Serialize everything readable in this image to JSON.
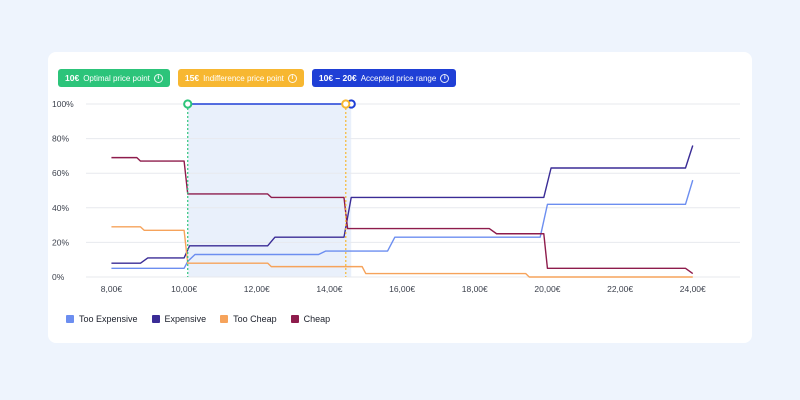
{
  "badges": [
    {
      "value": "10€",
      "label": "Optimal price point",
      "color": "#2cc47a"
    },
    {
      "value": "15€",
      "label": "Indifference price point",
      "color": "#f7b731"
    },
    {
      "value": "10€ – 20€",
      "label": "Accepted price range",
      "color": "#1f3fd6"
    }
  ],
  "info_glyph": "i",
  "chart_data": {
    "type": "line",
    "xlabel": "",
    "ylabel": "",
    "xlim": [
      7.3,
      25.3
    ],
    "ylim": [
      0,
      100
    ],
    "x_ticks": [
      8,
      10,
      12,
      14,
      16,
      18,
      20,
      22,
      24
    ],
    "x_tick_labels": [
      "8,00€",
      "10,00€",
      "12,00€",
      "14,00€",
      "16,00€",
      "18,00€",
      "20,00€",
      "22,00€",
      "24,00€"
    ],
    "y_ticks": [
      0,
      20,
      40,
      60,
      80,
      100
    ],
    "y_tick_labels": [
      "0%",
      "20%",
      "40%",
      "60%",
      "80%",
      "100%"
    ],
    "grid": true,
    "legend_position": "bottom-left",
    "series": [
      {
        "name": "Too Expensive",
        "color": "#6c8ef0",
        "x": [
          8.0,
          10.0,
          10.1,
          10.3,
          12.5,
          12.8,
          13.7,
          13.9,
          15.6,
          15.8,
          19.8,
          20.0,
          23.8,
          24.0
        ],
        "y": [
          5,
          5,
          9,
          13,
          13,
          13,
          13,
          15,
          15,
          23,
          23,
          42,
          42,
          56
        ]
      },
      {
        "name": "Expensive",
        "color": "#3a2c96",
        "x": [
          8.0,
          8.8,
          9.0,
          10.0,
          10.15,
          12.3,
          12.5,
          14.4,
          14.6,
          19.9,
          20.1,
          23.8,
          24.0
        ],
        "y": [
          8,
          8,
          11,
          11,
          18,
          18,
          23,
          23,
          46,
          46,
          63,
          63,
          76
        ]
      },
      {
        "name": "Too Cheap",
        "color": "#f6a35b",
        "x": [
          8.0,
          8.8,
          8.9,
          10.0,
          10.1,
          12.3,
          12.4,
          14.9,
          15.0,
          19.4,
          19.5,
          24.0
        ],
        "y": [
          29,
          29,
          27,
          27,
          8,
          8,
          6,
          6,
          2,
          2,
          0,
          0
        ]
      },
      {
        "name": "Cheap",
        "color": "#8e1c4c",
        "x": [
          8.0,
          8.7,
          8.8,
          10.0,
          10.1,
          12.3,
          12.4,
          14.4,
          14.5,
          18.4,
          18.6,
          19.9,
          20.0,
          23.8,
          24.0
        ],
        "y": [
          69,
          69,
          67,
          67,
          48,
          48,
          46,
          46,
          28,
          28,
          25,
          25,
          5,
          5,
          2
        ]
      }
    ],
    "markers": {
      "optimal_price": 10.1,
      "indifference_price": 14.45,
      "accepted_range": [
        10.1,
        14.6
      ],
      "optimal_color": "#2cc47a",
      "indifference_color": "#f7b731",
      "range_color": "#1f3fd6",
      "range_fill": "#e9f0fb"
    }
  }
}
